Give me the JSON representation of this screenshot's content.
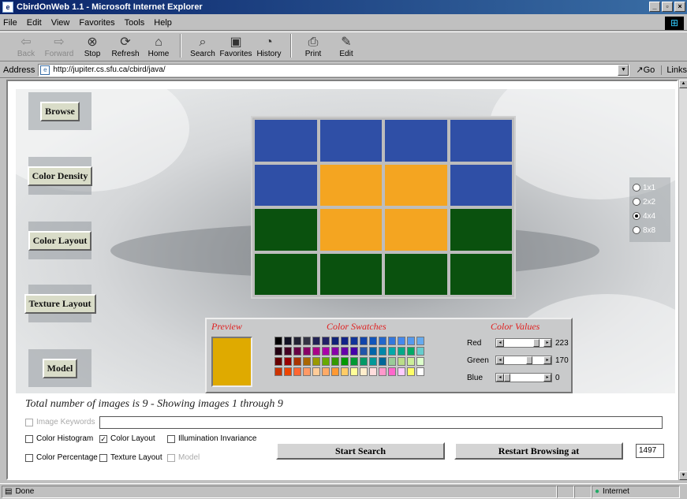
{
  "window": {
    "title": "CbirdOnWeb 1.1 - Microsoft Internet Explorer"
  },
  "menu": [
    "File",
    "Edit",
    "View",
    "Favorites",
    "Tools",
    "Help"
  ],
  "toolbar": {
    "back": "Back",
    "forward": "Forward",
    "stop": "Stop",
    "refresh": "Refresh",
    "home": "Home",
    "search": "Search",
    "favorites": "Favorites",
    "history": "History",
    "print": "Print",
    "edit": "Edit"
  },
  "address": {
    "label": "Address",
    "url": "http://jupiter.cs.sfu.ca/cbird/java/",
    "go": "Go",
    "links": "Links"
  },
  "nav_buttons": [
    "Browse",
    "Color Density",
    "Color Layout",
    "Texture Layout",
    "Model"
  ],
  "grid": {
    "colors": {
      "blue": "#2f4fa6",
      "orange": "#f4a521",
      "green": "#0a510e"
    },
    "cells": [
      [
        "blue",
        "blue",
        "blue",
        "blue"
      ],
      [
        "blue",
        "orange",
        "orange",
        "blue"
      ],
      [
        "green",
        "orange",
        "orange",
        "green"
      ],
      [
        "green",
        "green",
        "green",
        "green"
      ]
    ],
    "sizes": [
      "1x1",
      "2x2",
      "4x4",
      "8x8"
    ],
    "selected_size": "4x4"
  },
  "color_panel": {
    "preview_label": "Preview",
    "swatches_label": "Color Swatches",
    "values_label": "Color Values",
    "preview_color": "#dfaa00",
    "red_label": "Red",
    "red": 223,
    "green_label": "Green",
    "green": 170,
    "blue_label": "Blue",
    "blue": 0
  },
  "summary": "Total number of images is 9  -  Showing images 1 through 9",
  "options": {
    "image_keywords": "Image Keywords",
    "color_histogram": "Color Histogram",
    "color_layout": "Color Layout",
    "illumination_invariance": "Illumination Invariance",
    "color_percentage": "Color Percentage",
    "texture_layout": "Texture Layout",
    "model": "Model"
  },
  "buttons": {
    "start_search": "Start Search",
    "restart_browsing": "Restart Browsing at",
    "restart_value": "1497"
  },
  "status": {
    "text": "Done",
    "zone": "Internet"
  }
}
